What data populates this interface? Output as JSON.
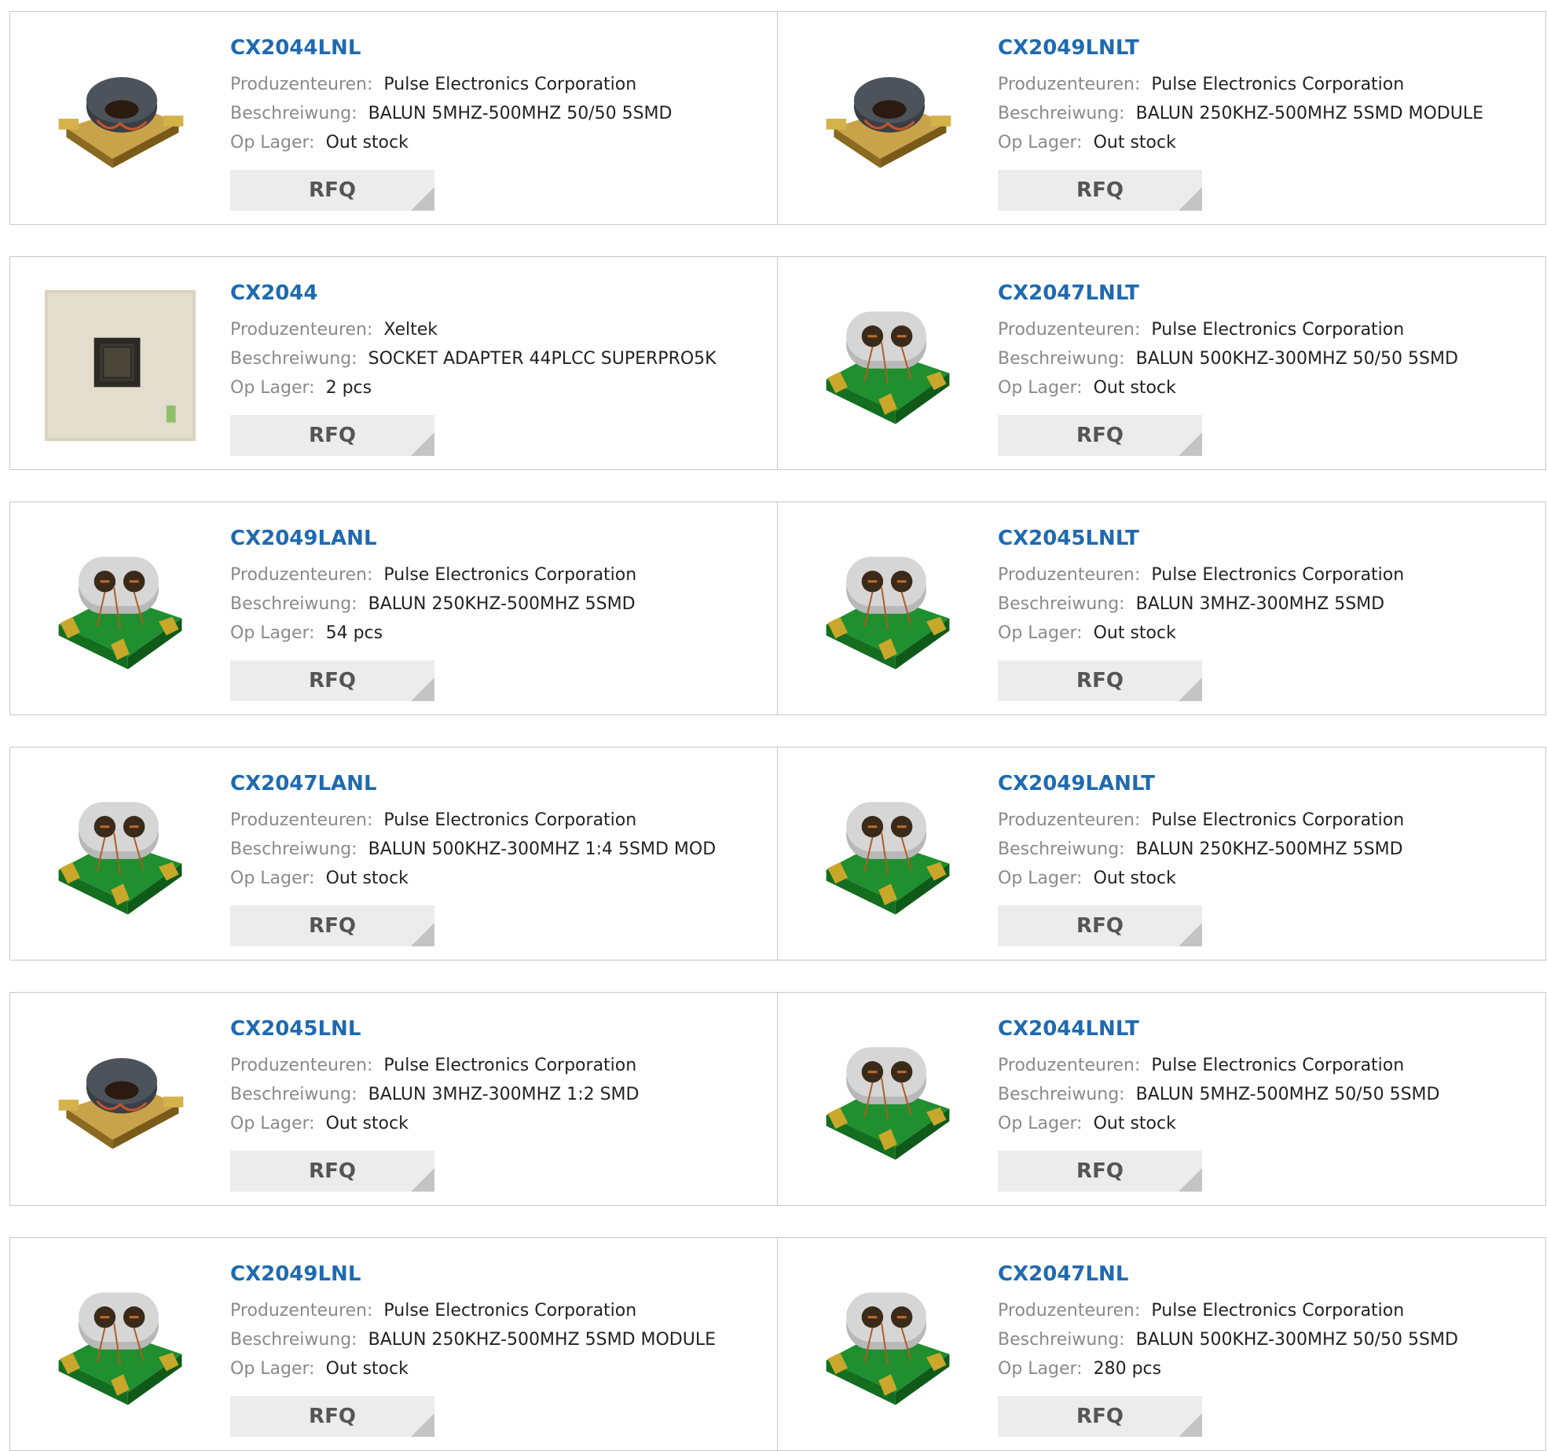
{
  "labels": {
    "manufacturer": "Produzenteuren:",
    "description": "Beschreiwung:",
    "stock": "Op Lager:",
    "rfq": "RFQ"
  },
  "colors": {
    "link": "#1f6ab0",
    "label": "#8a8a8a",
    "button_bg": "#ececec",
    "border": "#c8c8c8"
  },
  "products": [
    {
      "part": "CX2044LNL",
      "manufacturer": "Pulse Electronics Corporation",
      "description": "BALUN 5MHZ-500MHZ 50/50 5SMD",
      "stock": "Out stock",
      "image": "black-core-balun"
    },
    {
      "part": "CX2049LNLT",
      "manufacturer": "Pulse Electronics Corporation",
      "description": "BALUN 250KHZ-500MHZ 5SMD MODULE",
      "stock": "Out stock",
      "image": "black-core-balun"
    },
    {
      "part": "CX2044",
      "manufacturer": "Xeltek",
      "description": "SOCKET ADAPTER 44PLCC SUPERPRO5K",
      "stock": "2 pcs",
      "image": "socket-adapter"
    },
    {
      "part": "CX2047LNLT",
      "manufacturer": "Pulse Electronics Corporation",
      "description": "BALUN 500KHZ-300MHZ 50/50 5SMD",
      "stock": "Out stock",
      "image": "green-balun"
    },
    {
      "part": "CX2049LANL",
      "manufacturer": "Pulse Electronics Corporation",
      "description": "BALUN 250KHZ-500MHZ 5SMD",
      "stock": "54 pcs",
      "image": "green-balun"
    },
    {
      "part": "CX2045LNLT",
      "manufacturer": "Pulse Electronics Corporation",
      "description": "BALUN 3MHZ-300MHZ 5SMD",
      "stock": "Out stock",
      "image": "green-balun"
    },
    {
      "part": "CX2047LANL",
      "manufacturer": "Pulse Electronics Corporation",
      "description": "BALUN 500KHZ-300MHZ 1:4 5SMD MOD",
      "stock": "Out stock",
      "image": "green-balun"
    },
    {
      "part": "CX2049LANLT",
      "manufacturer": "Pulse Electronics Corporation",
      "description": "BALUN 250KHZ-500MHZ 5SMD",
      "stock": "Out stock",
      "image": "green-balun"
    },
    {
      "part": "CX2045LNL",
      "manufacturer": "Pulse Electronics Corporation",
      "description": "BALUN 3MHZ-300MHZ 1:2 SMD",
      "stock": "Out stock",
      "image": "black-core-balun"
    },
    {
      "part": "CX2044LNLT",
      "manufacturer": "Pulse Electronics Corporation",
      "description": "BALUN 5MHZ-500MHZ 50/50 5SMD",
      "stock": "Out stock",
      "image": "green-balun"
    },
    {
      "part": "CX2049LNL",
      "manufacturer": "Pulse Electronics Corporation",
      "description": "BALUN 250KHZ-500MHZ 5SMD MODULE",
      "stock": "Out stock",
      "image": "green-balun"
    },
    {
      "part": "CX2047LNL",
      "manufacturer": "Pulse Electronics Corporation",
      "description": "BALUN 500KHZ-300MHZ 50/50 5SMD",
      "stock": "280 pcs",
      "image": "green-balun"
    }
  ]
}
